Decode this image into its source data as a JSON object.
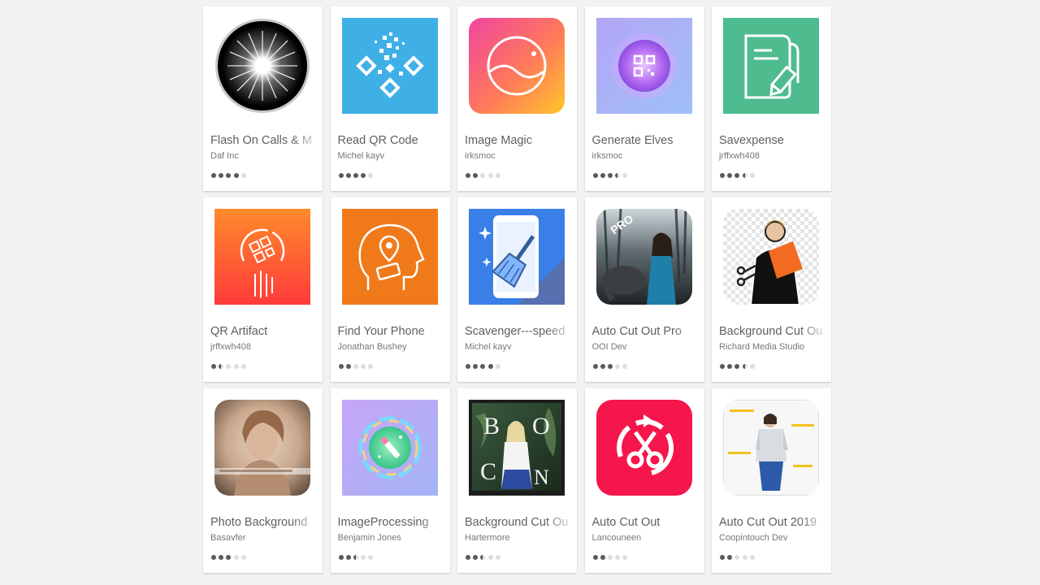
{
  "apps": [
    {
      "title": "Flash On Calls & M",
      "developer": "Daf Inc",
      "rating": 4,
      "icon": "flash-burst-icon"
    },
    {
      "title": "Read QR Code",
      "developer": "Michel kayv",
      "rating": 4,
      "icon": "qr-blocks-icon"
    },
    {
      "title": "Image Magic",
      "developer": "irksmoc",
      "rating": 2,
      "icon": "landscape-circle-icon"
    },
    {
      "title": "Generate Elves",
      "developer": "irksmoc",
      "rating": 3.5,
      "icon": "qr-orb-icon"
    },
    {
      "title": "Savexpense",
      "developer": "jrffxwh408",
      "rating": 3.5,
      "icon": "document-pen-icon"
    },
    {
      "title": "QR Artifact",
      "developer": "jrffxwh408",
      "rating": 1.5,
      "icon": "qr-artifact-icon"
    },
    {
      "title": "Find Your Phone",
      "developer": "Jonathan Bushey",
      "rating": 2,
      "icon": "head-location-pin-icon"
    },
    {
      "title": "Scavenger---speed",
      "developer": "Michel kayv",
      "rating": 4,
      "icon": "phone-broom-icon"
    },
    {
      "title": "Auto Cut Out Pro",
      "developer": "OOI Dev",
      "rating": 3,
      "icon": "photo-pro-icon"
    },
    {
      "title": "Background Cut Ou",
      "developer": "Richard Media Studio",
      "rating": 3.5,
      "icon": "cutout-person-icon"
    },
    {
      "title": "Photo Background",
      "developer": "Basavfer",
      "rating": 3,
      "icon": "portrait-photo-icon"
    },
    {
      "title": "ImageProcessing",
      "developer": "Benjamin Jones",
      "rating": 2.5,
      "icon": "magic-wand-circle-icon"
    },
    {
      "title": "Background Cut Ou",
      "developer": "Hartermore",
      "rating": 2.5,
      "icon": "boho-photo-icon"
    },
    {
      "title": "Auto Cut Out",
      "developer": "Lancouneen",
      "rating": 2,
      "icon": "scissors-refresh-icon"
    },
    {
      "title": "Auto Cut Out 2019",
      "developer": "Coopintouch Dev",
      "rating": 2,
      "icon": "model-photo-icon"
    }
  ],
  "colors": {
    "star_filled": "#5a5a5a",
    "star_empty": "#dedede",
    "title_text": "#5f5f5f",
    "developer_text": "#777777"
  }
}
